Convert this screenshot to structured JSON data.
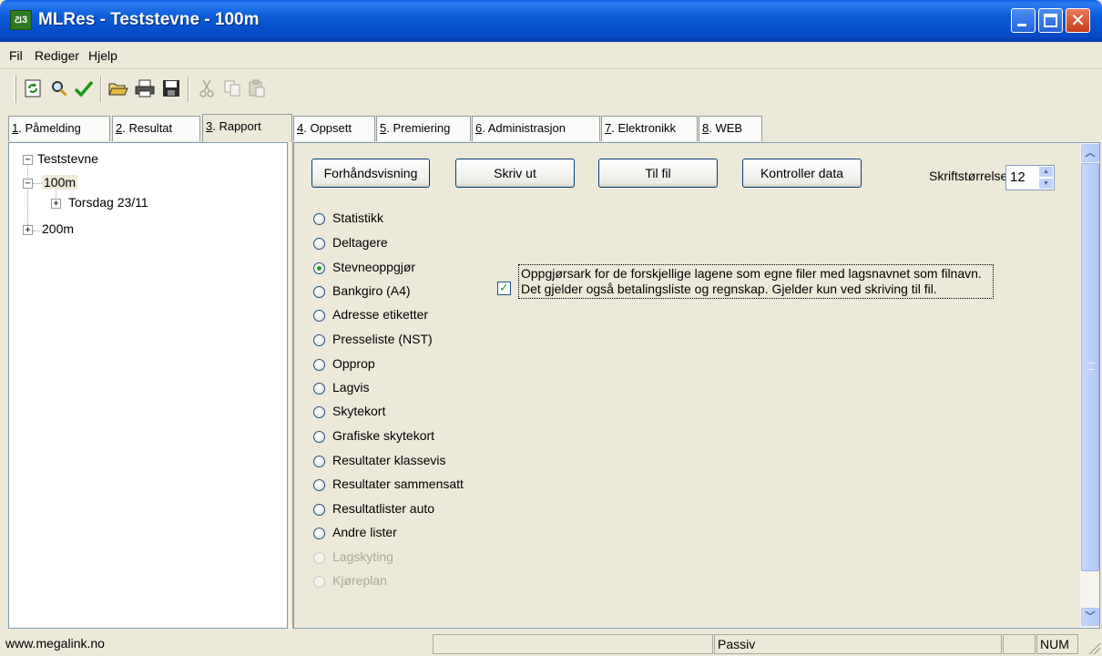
{
  "window": {
    "title": "MLRes - Teststevne - 100m",
    "app_icon_text": "ରର"
  },
  "menu": [
    "Fil",
    "Rediger",
    "Hjelp"
  ],
  "toolbar": {
    "buttons": [
      {
        "icon": "refresh-icon",
        "glyph": "🗘",
        "enabled": true
      },
      {
        "icon": "search-icon",
        "glyph": "🔍",
        "enabled": true
      },
      {
        "icon": "checkmark-icon",
        "glyph": "✓",
        "enabled": true
      },
      {
        "icon": "open-folder-icon",
        "glyph": "📂",
        "enabled": true
      },
      {
        "icon": "printer-icon",
        "glyph": "🖶",
        "enabled": true
      },
      {
        "icon": "save-icon",
        "glyph": "💾",
        "enabled": true
      },
      {
        "icon": "cut-icon",
        "glyph": "✂",
        "enabled": false
      },
      {
        "icon": "copy-icon",
        "glyph": "⎘",
        "enabled": false
      },
      {
        "icon": "paste-icon",
        "glyph": "📋",
        "enabled": false
      }
    ]
  },
  "tabs": [
    {
      "num": "1",
      "label": ". Påmelding"
    },
    {
      "num": "2",
      "label": ". Resultat"
    },
    {
      "num": "3",
      "label": ". Rapport",
      "active": true
    },
    {
      "num": "4",
      "label": ". Oppsett"
    },
    {
      "num": "5",
      "label": ". Premiering"
    },
    {
      "num": "6",
      "label": ". Administrasjon"
    },
    {
      "num": "7",
      "label": ". Elektronikk"
    },
    {
      "num": "8",
      "label": ". WEB"
    }
  ],
  "tree": {
    "root": "Teststevne",
    "children": [
      {
        "label": "100m",
        "expanded": true,
        "children": [
          {
            "label": "Torsdag 23/11"
          }
        ]
      },
      {
        "label": "200m",
        "expanded": false
      }
    ]
  },
  "report": {
    "buttons": {
      "preview": "Forhåndsvisning",
      "print": "Skriv ut",
      "to_file": "Til fil",
      "check": "Kontroller data"
    },
    "font_size_label": "Skriftstørrelse",
    "font_size_value": "12",
    "selected": "Stevneoppgjør",
    "options": [
      {
        "label": "Statistikk",
        "enabled": true
      },
      {
        "label": "Deltagere",
        "enabled": true
      },
      {
        "label": "Stevneoppgjør",
        "enabled": true
      },
      {
        "label": "Bankgiro (A4)",
        "enabled": true
      },
      {
        "label": "Adresse etiketter",
        "enabled": true
      },
      {
        "label": "Presseliste (NST)",
        "enabled": true
      },
      {
        "label": "Opprop",
        "enabled": true
      },
      {
        "label": "Lagvis",
        "enabled": true
      },
      {
        "label": "Skytekort",
        "enabled": true
      },
      {
        "label": "Grafiske skytekort",
        "enabled": true
      },
      {
        "label": "Resultater klassevis",
        "enabled": true
      },
      {
        "label": "Resultater sammensatt",
        "enabled": true
      },
      {
        "label": "Resultatlister auto",
        "enabled": true
      },
      {
        "label": "Andre lister",
        "enabled": true
      },
      {
        "label": "Lagskyting",
        "enabled": false
      },
      {
        "label": "Kjøreplan",
        "enabled": false
      }
    ],
    "checkbox": {
      "checked": true,
      "text": "Oppgjørsark for de forskjellige lagene som egne filer med lagsnavnet som filnavn. Det gjelder også betalingsliste og regnskap. Gjelder kun ved skriving til fil."
    }
  },
  "status": {
    "left": "www.megalink.no",
    "middle": "",
    "state": "Passiv",
    "blank": "",
    "num": "NUM"
  }
}
